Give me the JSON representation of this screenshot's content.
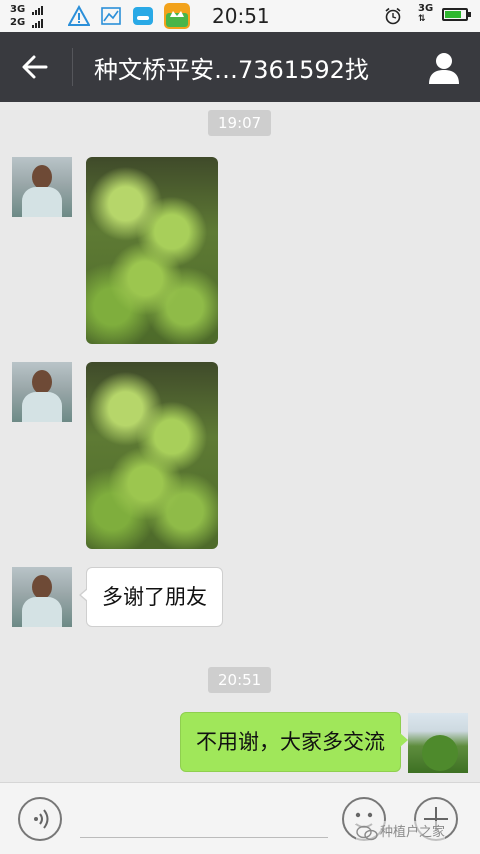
{
  "status_bar": {
    "network_top": "3G",
    "network_bottom": "2G",
    "time": "20:51",
    "network_right": "3G",
    "battery_level": 0.9
  },
  "header": {
    "title": "种文桥平安…7361592找"
  },
  "messages": [
    {
      "type": "timestamp",
      "text": "19:07"
    },
    {
      "type": "image",
      "side": "left"
    },
    {
      "type": "image",
      "side": "left"
    },
    {
      "type": "text",
      "side": "left",
      "text": "多谢了朋友"
    },
    {
      "type": "timestamp",
      "text": "20:51"
    },
    {
      "type": "text",
      "side": "right",
      "text": "不用谢，大家多交流"
    }
  ],
  "input_bar": {
    "watermark": "种植户之家"
  },
  "colors": {
    "header_bg": "#393a3f",
    "chat_bg": "#e9e9e9",
    "sent_bubble": "#a0e75a",
    "received_bubble": "#ffffff"
  }
}
